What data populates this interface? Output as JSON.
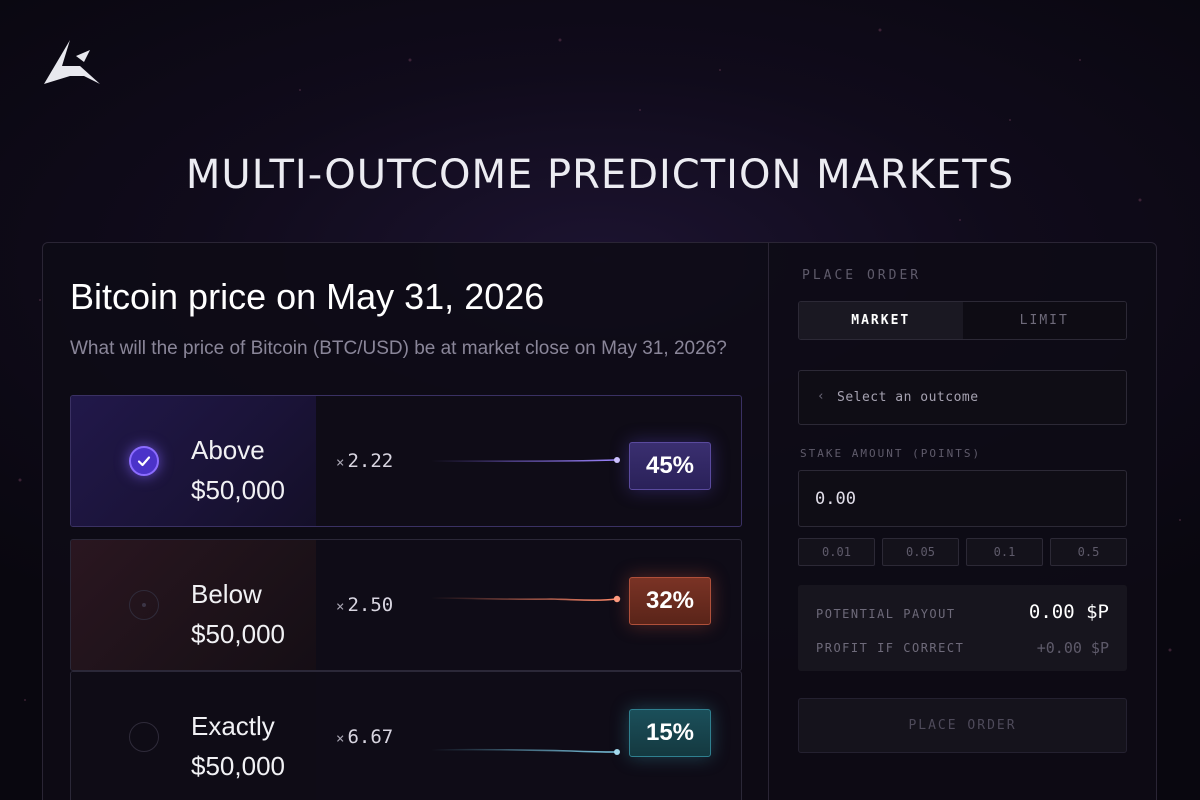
{
  "headline": "MULTI-OUTCOME PREDICTION MARKETS",
  "market": {
    "title": "Bitcoin price on May 31, 2026",
    "question": "What will the price of Bitcoin (BTC/USD) be at market close on May 31, 2026?"
  },
  "outcomes": [
    {
      "line1": "Above",
      "line2": "$50,000",
      "multiplier": "2.22",
      "percent": "45%",
      "probability": 0.45,
      "selected": true,
      "color": "#8b6cff"
    },
    {
      "line1": "Below",
      "line2": "$50,000",
      "multiplier": "2.50",
      "percent": "32%",
      "probability": 0.32,
      "selected": false,
      "color": "#f07a5e"
    },
    {
      "line1": "Exactly",
      "line2": "$50,000",
      "multiplier": "6.67",
      "percent": "15%",
      "probability": 0.15,
      "selected": false,
      "color": "#6ab8d6"
    }
  ],
  "multiplier_prefix": "×",
  "order": {
    "section_label": "PLACE ORDER",
    "tab_market": "MARKET",
    "tab_limit": "LIMIT",
    "select_prompt": "Select an outcome",
    "stake_label": "STAKE AMOUNT (POINTS)",
    "stake_value": "0.00",
    "chips": [
      "0.01",
      "0.05",
      "0.1",
      "0.5"
    ],
    "potential_payout_label": "POTENTIAL PAYOUT",
    "potential_payout_value": "0.00 $P",
    "profit_label": "PROFIT IF CORRECT",
    "profit_value": "+0.00 $P",
    "place_button": "PLACE ORDER"
  },
  "icons": {
    "logo": "brand-logo-icon",
    "check": "check-icon",
    "chevron": "chevron-left-icon"
  }
}
